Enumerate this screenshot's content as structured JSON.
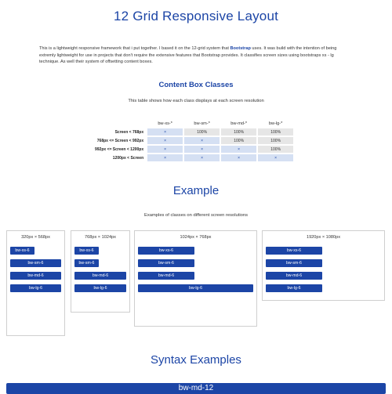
{
  "page_title": "12 Grid Responsive Layout",
  "intro": {
    "before_link": "This is a lightweight responsive framework that i put together. I based it on the 12-grid system that ",
    "link": "Bootstrap",
    "after_link": " uses. It was build with the intention of being extremly lightweight for use in projects that don't require the extensive features that Bootstrap provides. It classifies screen sizes using bootstraps xs - lg technique. As well their system of offsetting content boxes."
  },
  "content_box": {
    "heading": "Content Box Classes",
    "description": "This table shows how each class displays at each screen resolution",
    "columns": [
      "bw-xs-*",
      "bw-sm-*",
      "bw-md-*",
      "bw-lg-*"
    ],
    "rows": [
      {
        "label": "Screen < 768px",
        "cells": [
          "×",
          "100%",
          "100%",
          "100%"
        ]
      },
      {
        "label": "768px <= Screen < 992px",
        "cells": [
          "×",
          "×",
          "100%",
          "100%"
        ]
      },
      {
        "label": "992px <= Screen < 1200px",
        "cells": [
          "×",
          "×",
          "×",
          "100%"
        ]
      },
      {
        "label": "1200px < Screen",
        "cells": [
          "×",
          "×",
          "×",
          "×"
        ]
      }
    ]
  },
  "example": {
    "heading": "Example",
    "description": "Examples of classes on different screen resolutions",
    "panels": [
      {
        "label": "320px × 568px",
        "blocks": [
          "bw-xs-6",
          "bw-sm-6",
          "bw-md-6",
          "bw-lg-6"
        ],
        "fill": [
          0.47,
          1.0,
          1.0,
          1.0
        ]
      },
      {
        "label": "768px × 1024px",
        "blocks": [
          "bw-xs-6",
          "bw-sm-6",
          "bw-md-6",
          "bw-lg-6"
        ],
        "fill": [
          0.47,
          0.47,
          1.0,
          1.0
        ]
      },
      {
        "label": "1024px × 768px",
        "blocks": [
          "bw-xs-6",
          "bw-sm-6",
          "bw-md-6",
          "bw-lg-6"
        ],
        "fill": [
          0.49,
          0.49,
          0.49,
          1.0
        ]
      },
      {
        "label": "1920px × 1080px",
        "blocks": [
          "bw-xs-6",
          "bw-sm-6",
          "bw-md-6",
          "bw-lg-6"
        ],
        "fill": [
          0.49,
          0.49,
          0.49,
          0.49
        ]
      }
    ]
  },
  "syntax": {
    "heading": "Syntax Examples",
    "bar_label": "bw-md-12"
  },
  "colors": {
    "accent": "#1c45a6",
    "x_cell": "#d5e0f3",
    "pct_cell": "#e6e6e6"
  }
}
